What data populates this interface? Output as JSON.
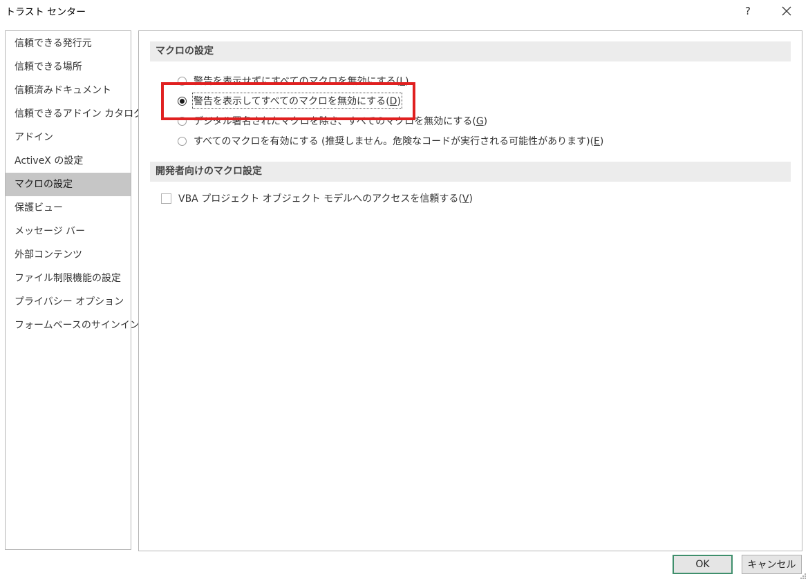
{
  "window": {
    "title": "トラスト センター",
    "help_label": "?",
    "close_label": "×"
  },
  "sidebar": {
    "items": [
      {
        "label": "信頼できる発行元",
        "selected": false
      },
      {
        "label": "信頼できる場所",
        "selected": false
      },
      {
        "label": "信頼済みドキュメント",
        "selected": false
      },
      {
        "label": "信頼できるアドイン カタログ",
        "selected": false
      },
      {
        "label": "アドイン",
        "selected": false
      },
      {
        "label": "ActiveX の設定",
        "selected": false
      },
      {
        "label": "マクロの設定",
        "selected": true
      },
      {
        "label": "保護ビュー",
        "selected": false
      },
      {
        "label": "メッセージ バー",
        "selected": false
      },
      {
        "label": "外部コンテンツ",
        "selected": false
      },
      {
        "label": "ファイル制限機能の設定",
        "selected": false
      },
      {
        "label": "プライバシー オプション",
        "selected": false
      },
      {
        "label": "フォームベースのサインイン",
        "selected": false
      }
    ]
  },
  "main": {
    "macro_section": {
      "header": "マクロの設定",
      "options": [
        {
          "text": "警告を表示せずにすべてのマクロを無効にする",
          "access_key": "L",
          "checked": false
        },
        {
          "text": "警告を表示してすべてのマクロを無効にする",
          "access_key": "D",
          "checked": true
        },
        {
          "text": "デジタル署名されたマクロを除き、すべてのマクロを無効にする",
          "access_key": "G",
          "checked": false
        },
        {
          "text": "すべてのマクロを有効にする (推奨しません。危険なコードが実行される可能性があります)",
          "access_key": "E",
          "checked": false
        }
      ]
    },
    "developer_section": {
      "header": "開発者向けのマクロ設定",
      "vba_access": {
        "text": "VBA プロジェクト オブジェクト モデルへのアクセスを信頼する",
        "access_key": "V",
        "checked": false
      }
    }
  },
  "buttons": {
    "ok": "OK",
    "cancel": "キャンセル"
  },
  "colors": {
    "highlight_box": "#e02020",
    "selected_item_bg": "#c6c6c6",
    "section_header_bg": "#ececec",
    "ok_border": "#3f8f6c"
  }
}
